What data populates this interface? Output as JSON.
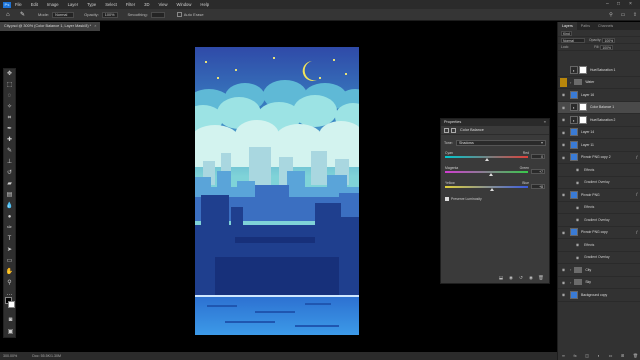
{
  "app": {
    "logo": "Ps",
    "menu": [
      "File",
      "Edit",
      "Image",
      "Layer",
      "Type",
      "Select",
      "Filter",
      "3D",
      "View",
      "Window",
      "Help"
    ]
  },
  "options_bar": {
    "mode_label": "Mode:",
    "mode_value": "Normal",
    "opacity_label": "Opacity:",
    "opacity_value": "100%",
    "smoothing_label": "Smoothing:",
    "smoothing_value": "",
    "autoerase_label": "Auto Erase"
  },
  "document_tab": {
    "title": "City.psd @ 300% (Color Balance 1, Layer Mask/8) *",
    "close": "×"
  },
  "properties_panel": {
    "title": "Properties",
    "subtitle": "Color Balance",
    "tone_label": "Tone:",
    "tone_value": "Shadows",
    "sliders": [
      {
        "left": "Cyan",
        "right": "Red",
        "value": "0",
        "position": 0.5,
        "colors": [
          "#00c8d0",
          "#e0403a"
        ]
      },
      {
        "left": "Magenta",
        "right": "Green",
        "value": "+7",
        "position": 0.55,
        "colors": [
          "#d03cd0",
          "#38c84a"
        ]
      },
      {
        "left": "Yellow",
        "right": "Blue",
        "value": "+8",
        "position": 0.56,
        "colors": [
          "#e0d03a",
          "#3a5ae0"
        ]
      }
    ],
    "preserve_label": "Preserve Luminosity"
  },
  "layers_panel": {
    "tabs": [
      "Layers",
      "Paths",
      "Channels"
    ],
    "kind_label": "Kind",
    "blend_mode": "Normal",
    "opacity_label": "Opacity:",
    "opacity_value": "100%",
    "lock_label": "Lock:",
    "fill_label": "Fill:",
    "fill_value": "100%",
    "layers": [
      {
        "name": "Hue/Saturation 1",
        "type": "adjust",
        "visible": false
      },
      {
        "name": "Water",
        "type": "folder",
        "visible": false,
        "highlight_gold": true
      },
      {
        "name": "Layer 16",
        "type": "pixel",
        "visible": true
      },
      {
        "name": "Color Balance 1",
        "type": "adjust",
        "visible": true,
        "selected": true
      },
      {
        "name": "Hue/Saturation 2",
        "type": "adjust",
        "visible": true
      },
      {
        "name": "Layer 14",
        "type": "pixel",
        "visible": true
      },
      {
        "name": "Layer 11",
        "type": "pixel",
        "visible": true
      },
      {
        "name": "Pixnoir PNG copy 2",
        "type": "pixel",
        "visible": true,
        "fx": true
      },
      {
        "name": "Effects",
        "type": "effects",
        "visible": true,
        "sub": true
      },
      {
        "name": "Gradient Overlay",
        "type": "effect",
        "visible": true,
        "sub": true
      },
      {
        "name": "Pixnoir PNG",
        "type": "pixel",
        "visible": true,
        "fx": true
      },
      {
        "name": "Effects",
        "type": "effects",
        "visible": true,
        "sub": true
      },
      {
        "name": "Gradient Overlay",
        "type": "effect",
        "visible": true,
        "sub": true
      },
      {
        "name": "Pixnoir PNG copy",
        "type": "pixel",
        "visible": true,
        "fx": true
      },
      {
        "name": "Effects",
        "type": "effects",
        "visible": true,
        "sub": true
      },
      {
        "name": "Gradient Overlay",
        "type": "effect",
        "visible": true,
        "sub": true
      },
      {
        "name": "City",
        "type": "folder",
        "visible": true
      },
      {
        "name": "Sky",
        "type": "folder",
        "visible": true
      },
      {
        "name": "Background copy",
        "type": "pixel",
        "visible": true
      }
    ]
  },
  "status_bar": {
    "zoom": "300.00%",
    "doc": "Doc: 55.5K/1.30M"
  }
}
